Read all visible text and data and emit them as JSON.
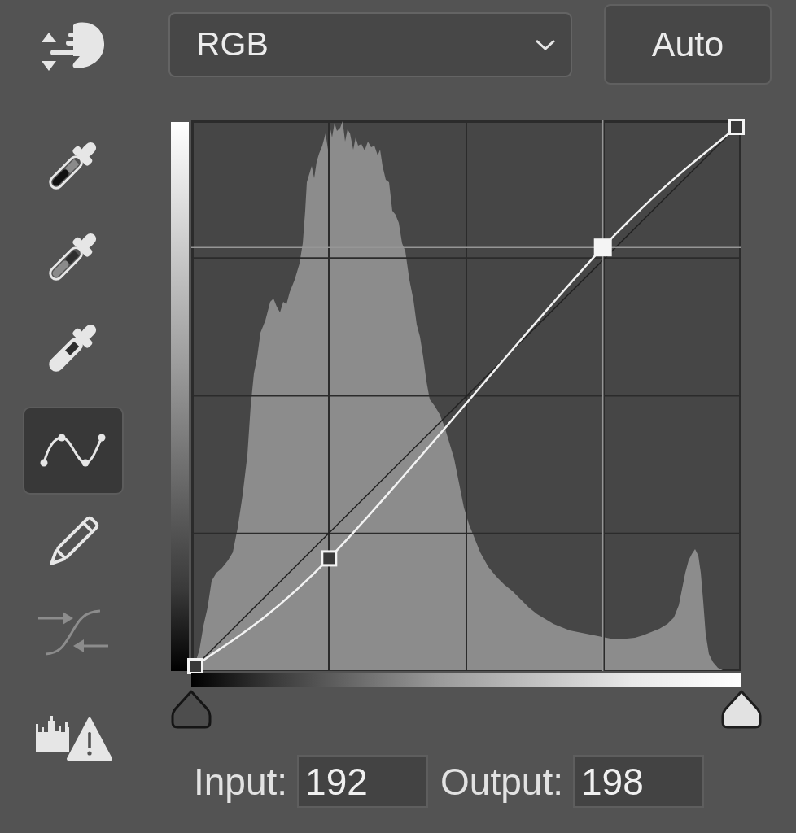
{
  "toolbar": {
    "groups": [
      {
        "tools": [
          {
            "kind": "target-adjust",
            "selected": false,
            "disabled": false
          }
        ]
      },
      {
        "tools": [
          {
            "kind": "black-eyedropper",
            "selected": false,
            "disabled": false
          },
          {
            "kind": "gray-eyedropper",
            "selected": false,
            "disabled": false
          },
          {
            "kind": "white-eyedropper",
            "selected": false,
            "disabled": false
          }
        ]
      },
      {
        "tools": [
          {
            "kind": "edit-points",
            "selected": true,
            "disabled": false
          },
          {
            "kind": "pencil",
            "selected": false,
            "disabled": false
          },
          {
            "kind": "smooth",
            "selected": false,
            "disabled": true
          }
        ]
      },
      {
        "tools": [
          {
            "kind": "clipping-warning",
            "selected": false,
            "disabled": false
          }
        ]
      }
    ]
  },
  "channel_dropdown": {
    "value": "RGB"
  },
  "auto_button": {
    "label": "Auto"
  },
  "curve": {
    "points": [
      {
        "selected": false
      },
      {
        "selected": false
      },
      {
        "selected": true
      },
      {
        "selected": false
      }
    ]
  },
  "input_sliders": [
    {
      "kind": "black-point",
      "level": 0
    },
    {
      "kind": "white-point",
      "level": 1
    }
  ],
  "values": {
    "input_label": "Input:",
    "input_value": "192",
    "output_label": "Output:",
    "output_value": "198"
  }
}
